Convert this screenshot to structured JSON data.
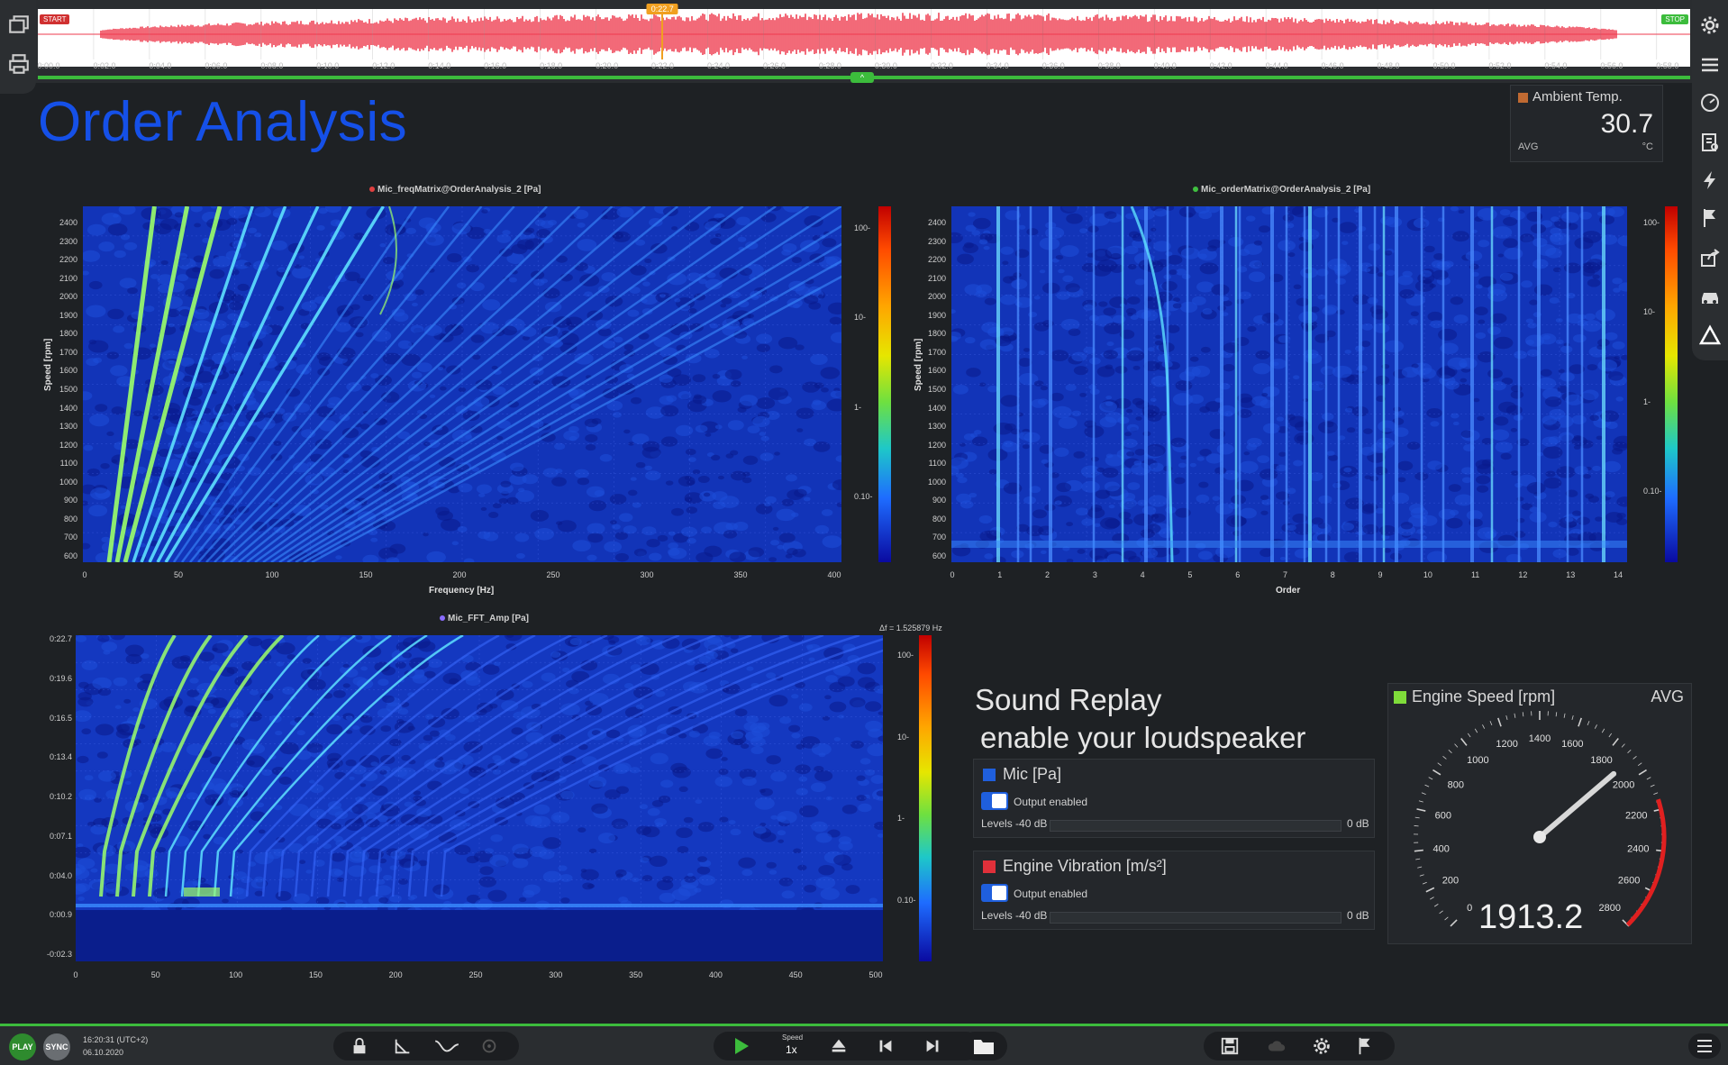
{
  "timeline": {
    "start_flag": "START",
    "stop_flag": "STOP",
    "cursor_label": "0:22.7",
    "ticks": [
      "0:00.0",
      "0:02.0",
      "0:04.0",
      "0:06.0",
      "0:08.0",
      "0:10.0",
      "0:12.0",
      "0:14.0",
      "0:16.0",
      "0:18.0",
      "0:20.0",
      "0:22.0",
      "0:24.0",
      "0:26.0",
      "0:28.0",
      "0:30.0",
      "0:32.0",
      "0:34.0",
      "0:36.0",
      "0:38.0",
      "0:40.0",
      "0:42.0",
      "0:44.0",
      "0:46.0",
      "0:48.0",
      "0:50.0",
      "0:52.0",
      "0:54.0",
      "0:56.0",
      "0:58.0"
    ],
    "waveform_color": "#ef3a4e",
    "cursor_position": 0.378
  },
  "page_title": "Order Analysis",
  "ambient": {
    "label": "Ambient Temp.",
    "value": "30.7",
    "stat": "AVG",
    "unit": "°C",
    "color": "#c06a32"
  },
  "plot_freq": {
    "title": "Mic_freqMatrix@OrderAnalysis_2 [Pa]",
    "dot_color": "#e04040",
    "ylabel": "Speed [rpm]",
    "xlabel": "Frequency [Hz]",
    "yticks": [
      "2400",
      "2300",
      "2200",
      "2100",
      "2000",
      "1900",
      "1800",
      "1700",
      "1600",
      "1500",
      "1400",
      "1300",
      "1200",
      "1100",
      "1000",
      "900",
      "800",
      "700",
      "600"
    ],
    "xticks": [
      "0",
      "50",
      "100",
      "150",
      "200",
      "250",
      "300",
      "350",
      "400"
    ],
    "cbar_ticks": [
      "100-",
      "10-",
      "1-",
      "0.10-"
    ]
  },
  "plot_order": {
    "title": "Mic_orderMatrix@OrderAnalysis_2 [Pa]",
    "dot_color": "#40c040",
    "ylabel": "Speed [rpm]",
    "xlabel": "Order",
    "yticks": [
      "2400",
      "2300",
      "2200",
      "2100",
      "2000",
      "1900",
      "1800",
      "1700",
      "1600",
      "1500",
      "1400",
      "1300",
      "1200",
      "1100",
      "1000",
      "900",
      "800",
      "700",
      "600"
    ],
    "xticks": [
      "0",
      "1",
      "2",
      "3",
      "4",
      "5",
      "6",
      "7",
      "8",
      "9",
      "10",
      "11",
      "12",
      "13",
      "14"
    ],
    "cbar_ticks": [
      "100-",
      "10-",
      "1-",
      "0.10-"
    ]
  },
  "plot_fft": {
    "title": "Mic_FFT_Amp [Pa]",
    "dot_color": "#8a6cff",
    "df_label": "Δf = 1.525879 Hz",
    "yticks": [
      "0:22.7",
      "0:19.6",
      "0:16.5",
      "0:13.4",
      "0:10.2",
      "0:07.1",
      "0:04.0",
      "0:00.9",
      "-0:02.3"
    ],
    "xticks": [
      "0",
      "50",
      "100",
      "150",
      "200",
      "250",
      "300",
      "350",
      "400",
      "450",
      "500"
    ],
    "cbar_ticks": [
      "100-",
      "10-",
      "1-",
      "0.10-"
    ]
  },
  "sound_replay": {
    "heading1": "Sound Replay",
    "heading2": "enable your loudspeaker",
    "channels": [
      {
        "name": "Mic [Pa]",
        "color": "#1f5fdd",
        "output": "Output enabled",
        "levels": "Levels -40 dB",
        "max": "0 dB"
      },
      {
        "name": "Engine Vibration [m/s²]",
        "color": "#e0303a",
        "output": "Output enabled",
        "levels": "Levels -40 dB",
        "max": "0 dB"
      }
    ]
  },
  "gauge": {
    "label": "Engine Speed [rpm]",
    "stat": "AVG",
    "value": "1913.2",
    "value_num": 1913.2,
    "max": 2800,
    "color": "#7fdc3a",
    "ticks": [
      "0",
      "200",
      "400",
      "600",
      "800",
      "1000",
      "1200",
      "1400",
      "1600",
      "1800",
      "2000",
      "2200",
      "2400",
      "2600",
      "2800"
    ]
  },
  "bottom": {
    "play_label": "PLAY",
    "sync_label": "SYNC",
    "time": "16:20:31 (UTC+2)",
    "date": "06.10.2020",
    "speed_label": "Speed",
    "speed_value": "1x"
  },
  "icons": [
    "layers-icon",
    "print-icon",
    "gear-icon",
    "list-icon",
    "gauge-icon",
    "report-icon",
    "lightning-icon",
    "flag-icon",
    "export-icon",
    "car-icon",
    "warning-icon",
    "lock-icon",
    "cursor-measure-icon",
    "curve-icon",
    "target-icon",
    "play-icon",
    "eject-icon",
    "skip-back-icon",
    "skip-forward-icon",
    "folder-icon",
    "save-icon",
    "cloud-icon",
    "settings-icon",
    "flag-icon",
    "menu-icon"
  ]
}
